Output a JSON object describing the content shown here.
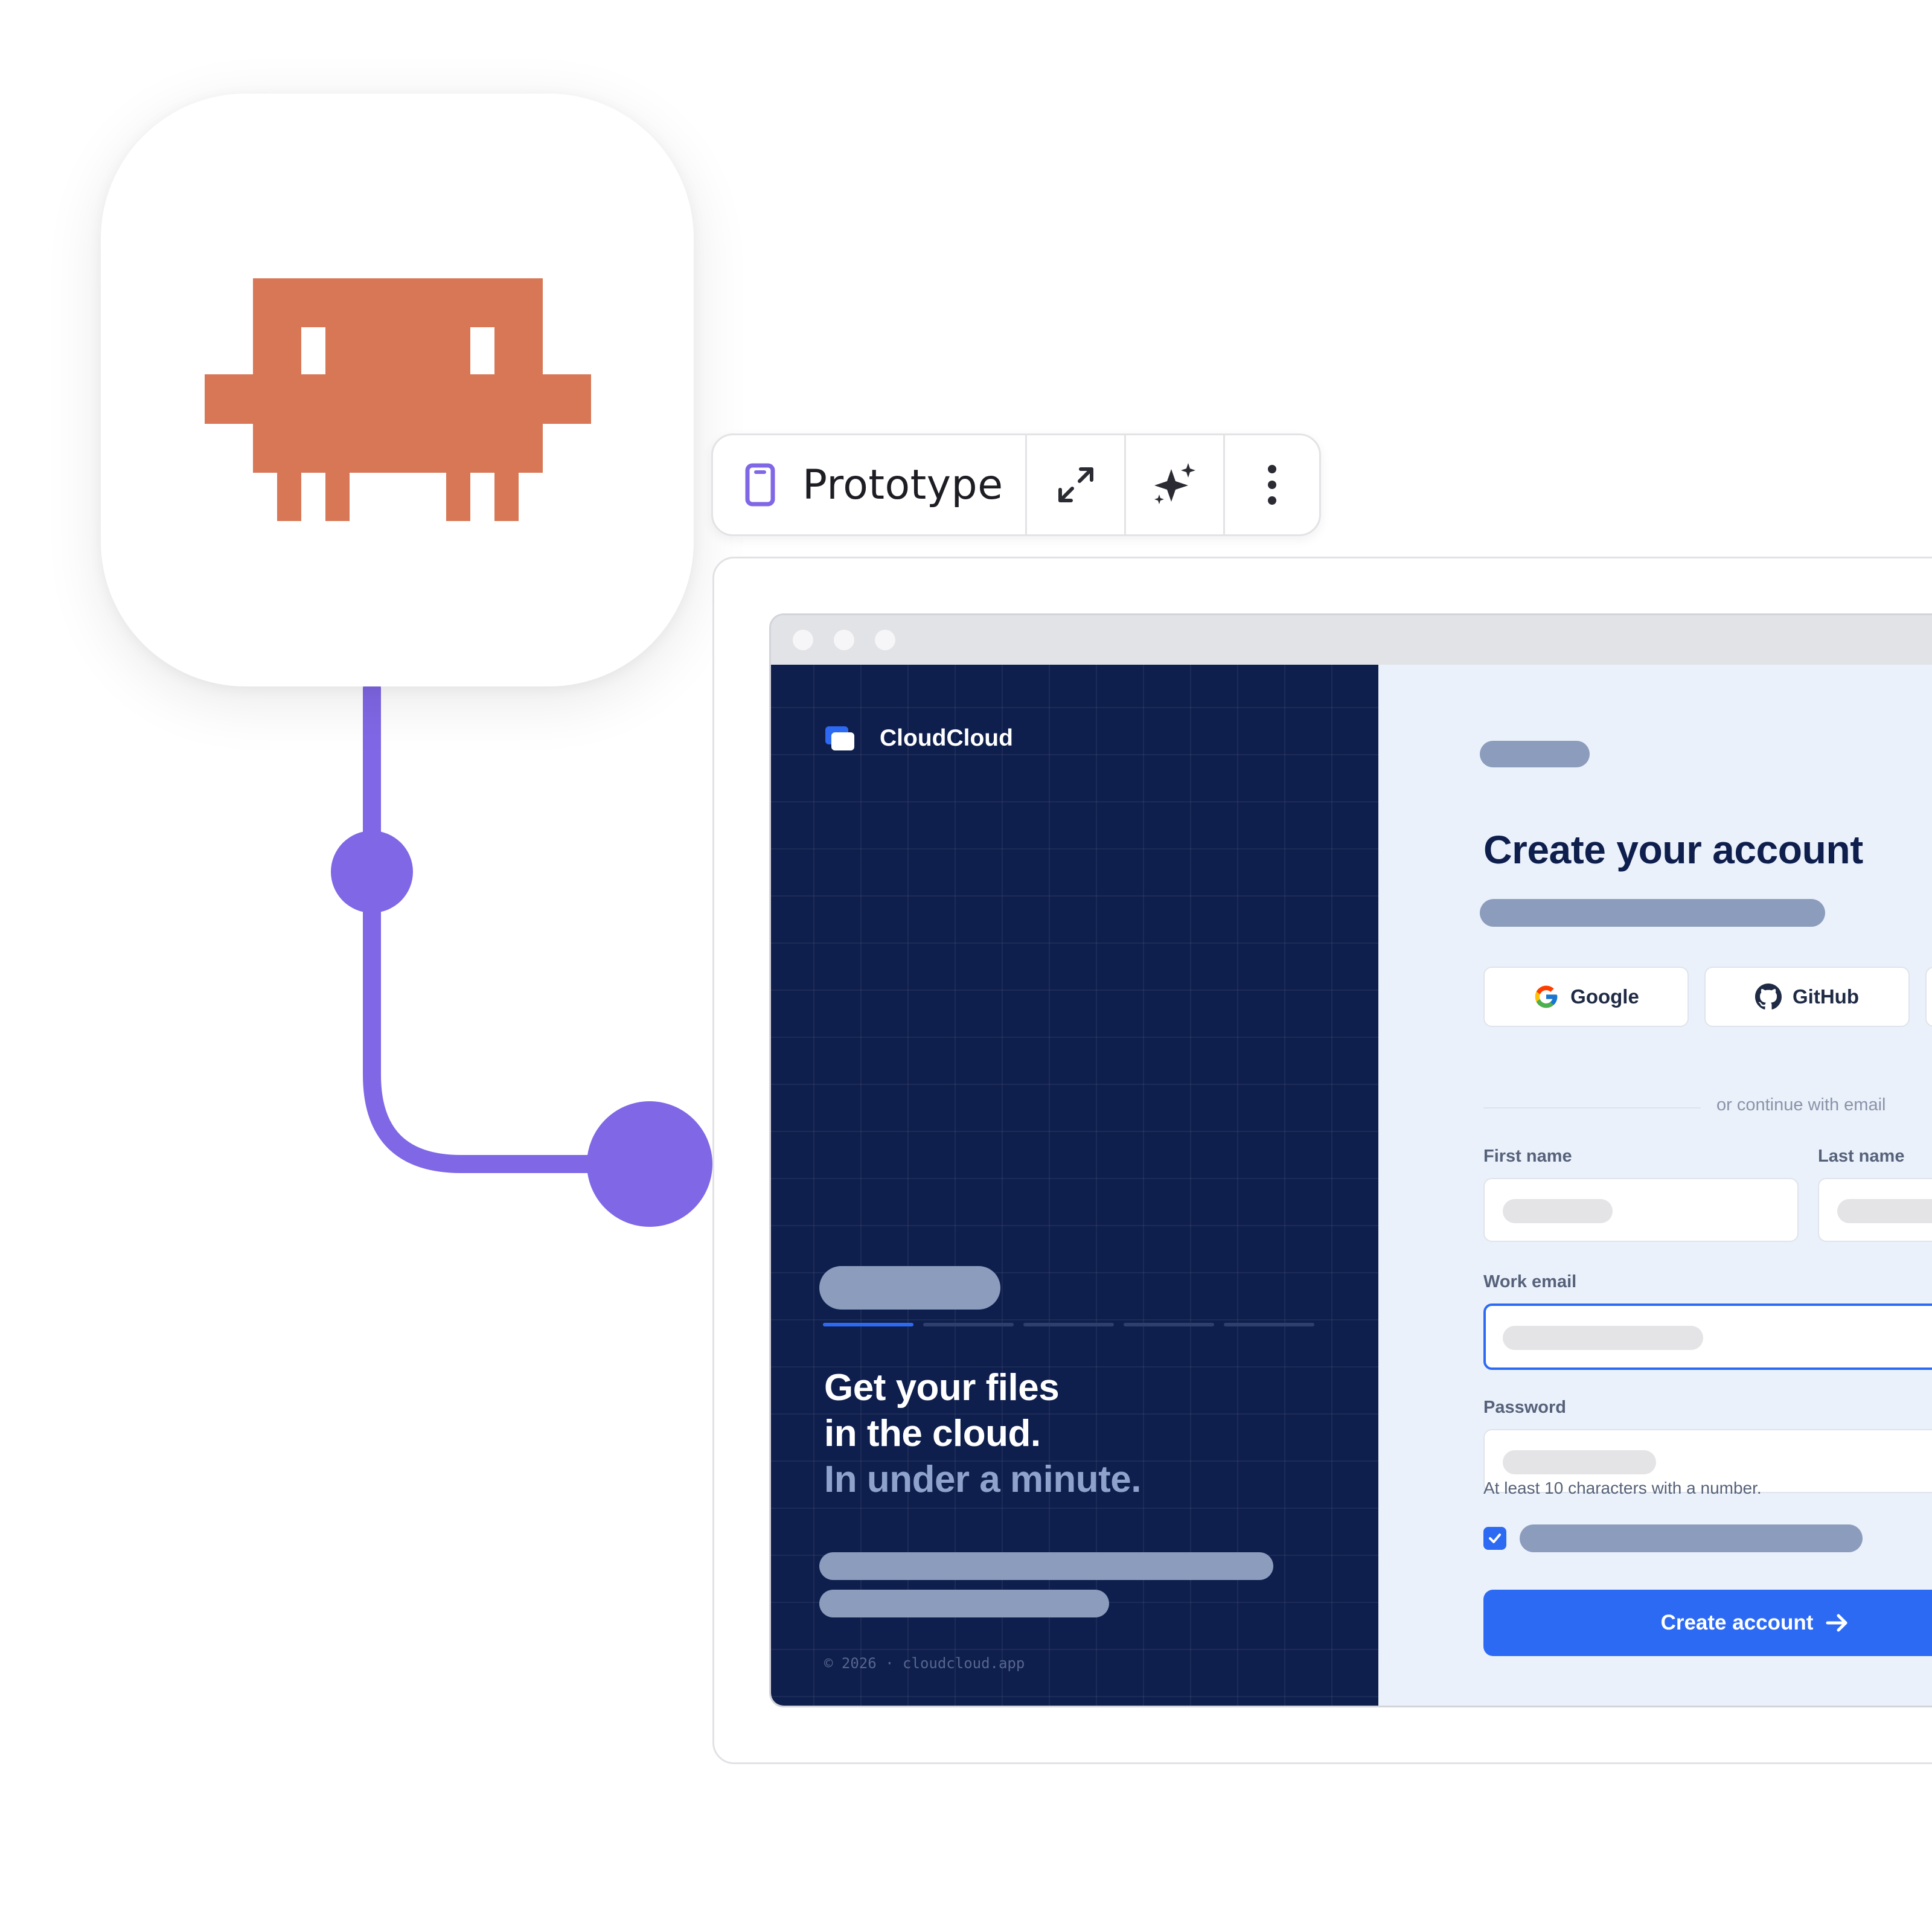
{
  "colors": {
    "accent": "#2d6af4",
    "connector": "#8067e6",
    "mascot": "#d77755",
    "dark_panel": "#0f1f4d"
  },
  "toolbar": {
    "prototype_label": "Prototype",
    "prototype_icon": "phone-icon",
    "expand_icon": "expand-icon",
    "ai_icon": "sparkle-icon",
    "more_icon": "more-vertical-icon"
  },
  "app_icon": {
    "icon": "pixel-mascot-icon"
  },
  "left_panel": {
    "brand": "CloudCloud",
    "hero_line1": "Get your files",
    "hero_line2": "in the cloud.",
    "hero_line3": "In under a minute.",
    "footer": "© 2026 · cloudcloud.app"
  },
  "form": {
    "title": "Create your account",
    "social": [
      {
        "label": "Google",
        "icon": "google-icon"
      },
      {
        "label": "GitHub",
        "icon": "github-icon"
      }
    ],
    "divider_text": "or continue with email",
    "first_name_label": "First name",
    "last_name_label": "Last name",
    "work_email_label": "Work email",
    "password_label": "Password",
    "password_hint": "At least 10 characters with a number.",
    "terms_checked": true,
    "submit_label": "Create account"
  }
}
